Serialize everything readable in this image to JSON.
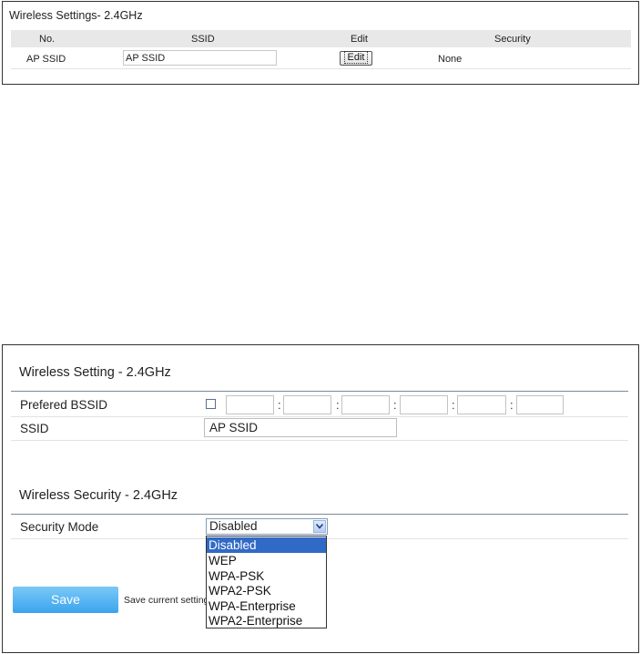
{
  "panel_top": {
    "title": "Wireless Settings- 2.4GHz",
    "columns": [
      "No.",
      "SSID",
      "Edit",
      "Security"
    ],
    "row": {
      "no": "AP SSID",
      "ssid": "AP SSID",
      "edit_label": "Edit",
      "security": "None"
    }
  },
  "panel_bottom": {
    "wireless_setting_title": "Wireless Setting - 2.4GHz",
    "prefered_bssid_label": "Prefered BSSID",
    "ssid_label": "SSID",
    "ssid_value": "AP SSID",
    "wireless_security_title": "Wireless Security - 2.4GHz",
    "security_mode_label": "Security Mode",
    "security_mode_value": "Disabled",
    "security_mode_options": [
      "Disabled",
      "WEP",
      "WPA-PSK",
      "WPA2-PSK",
      "WPA-Enterprise",
      "WPA2-Enterprise"
    ],
    "save_label": "Save",
    "save_note": "Save current settings"
  },
  "colors": {
    "save_button": "#3aa4ee",
    "selected_option": "#3169c6",
    "section_rule": "#7a8a99"
  }
}
